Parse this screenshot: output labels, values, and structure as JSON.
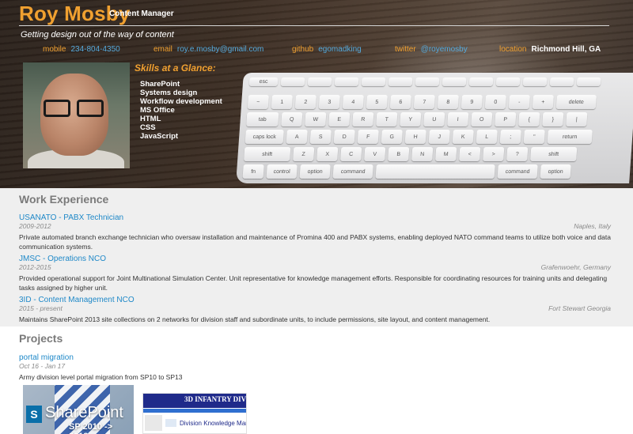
{
  "header": {
    "name": "Roy Mosby",
    "role": "Content Manager",
    "tagline": "Getting design out of the way of content",
    "contacts": [
      {
        "label": "mobile",
        "value": "234-804-4350"
      },
      {
        "label": "email",
        "value": "roy.e.mosby@gmail.com"
      },
      {
        "label": "github",
        "value": "egomadking"
      },
      {
        "label": "twitter",
        "value": "@royemosby"
      },
      {
        "label": "location",
        "value": "Richmond Hill, GA"
      }
    ],
    "photo_icon": "portrait-photo"
  },
  "skills": {
    "title": "Skills at a Glance:",
    "items": [
      "SharePoint",
      "Systems design",
      "Workflow development",
      "MS Office",
      "HTML",
      "CSS",
      "JavaScript"
    ]
  },
  "keyboard": {
    "rows": [
      [
        "esc",
        "",
        "",
        "",
        "",
        "",
        "",
        "",
        "",
        "",
        "",
        "",
        ""
      ],
      [
        "~",
        "1",
        "2",
        "3",
        "4",
        "5",
        "6",
        "7",
        "8",
        "9",
        "0",
        "-",
        "+",
        "delete"
      ],
      [
        "tab",
        "Q",
        "W",
        "E",
        "R",
        "T",
        "Y",
        "U",
        "I",
        "O",
        "P",
        "{",
        "}",
        "|"
      ],
      [
        "caps lock",
        "A",
        "S",
        "D",
        "F",
        "G",
        "H",
        "J",
        "K",
        "L",
        ";",
        "\"",
        "return"
      ],
      [
        "shift",
        "Z",
        "X",
        "C",
        "V",
        "B",
        "N",
        "M",
        "<",
        ">",
        "?",
        "shift"
      ],
      [
        "fn",
        "control",
        "option",
        "command",
        "",
        "command",
        "option"
      ]
    ]
  },
  "work": {
    "title": "Work Experience",
    "jobs": [
      {
        "title": "USANATO - PABX Technician",
        "dates": "2009-2012",
        "location": "Naples, Italy",
        "description": "Private automated branch exchange technician who oversaw installation and maintenance of Promina 400 and PABX systems, enabling deployed NATO command teams to utilize both voice and data communication systems."
      },
      {
        "title": "JMSC - Operations NCO",
        "dates": "2012-2015",
        "location": "Grafenwoehr, Germany",
        "description": "Provided operational support for Joint Multinational Simulation Center. Unit representative for knowledge management efforts. Responsible for coordinating resources for training units and delegating tasks assigned by higher unit."
      },
      {
        "title": "3ID - Content Management NCO",
        "dates": "2015 - present",
        "location": "Fort Stewart Georgia",
        "description": "Maintains SharePoint 2013 site collections on 2 networks for division staff and subordinate units, to include permissions, site layout, and content management."
      }
    ]
  },
  "projects": {
    "title": "Projects",
    "items": [
      {
        "title": "portal migration",
        "dates": "Oct 16 - Jan 17",
        "description": "Army division level portal migration from SP10 to SP13",
        "images": [
          {
            "text": "SharePoint",
            "sub": "SP 2010 -> 2013",
            "icon": "sharepoint-logo-icon"
          },
          {
            "banner": "3D INFANTRY DIVIS",
            "text": "Division Knowledge Manag"
          }
        ]
      }
    ]
  },
  "colors": {
    "accent": "#f0a030",
    "link": "#1e88c8",
    "section_bg": "#efefef"
  }
}
